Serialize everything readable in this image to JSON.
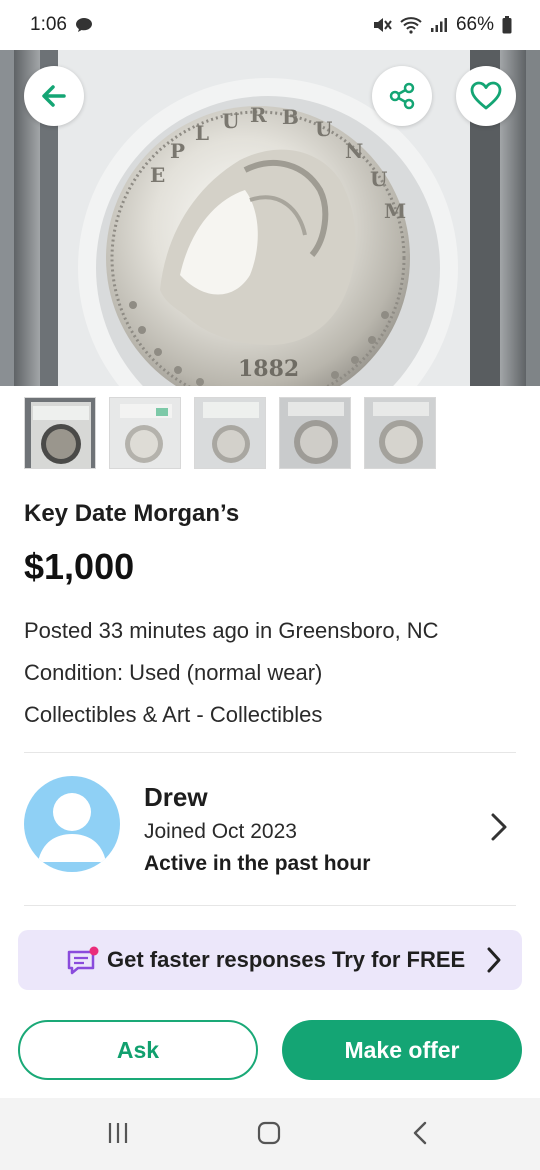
{
  "status_bar": {
    "time": "1:06",
    "battery": "66%"
  },
  "listing": {
    "title": "Key Date Morgan’s",
    "price": "$1,000",
    "posted": "Posted 33 minutes ago in Greensboro, NC",
    "condition": "Condition: Used (normal wear)",
    "category": "Collectibles & Art - Collectibles",
    "thumbnail_count": 5
  },
  "seller": {
    "name": "Drew",
    "joined": "Joined  Oct 2023",
    "activity": "Active in the past hour"
  },
  "promo": {
    "text": "Get faster responses Try for FREE"
  },
  "actions": {
    "ask": "Ask",
    "make_offer": "Make offer"
  },
  "icons": {
    "back": "back-arrow-icon",
    "share": "share-icon",
    "favorite": "heart-icon",
    "seller_chevron": "chevron-right-icon",
    "promo": "chat-sparkle-icon",
    "nav_recents": "recents-icon",
    "nav_home": "home-icon",
    "nav_back": "back-icon"
  },
  "colors": {
    "accent": "#14a574",
    "promo_bg": "#ece7fa",
    "avatar_bg": "#8fd0f5"
  }
}
